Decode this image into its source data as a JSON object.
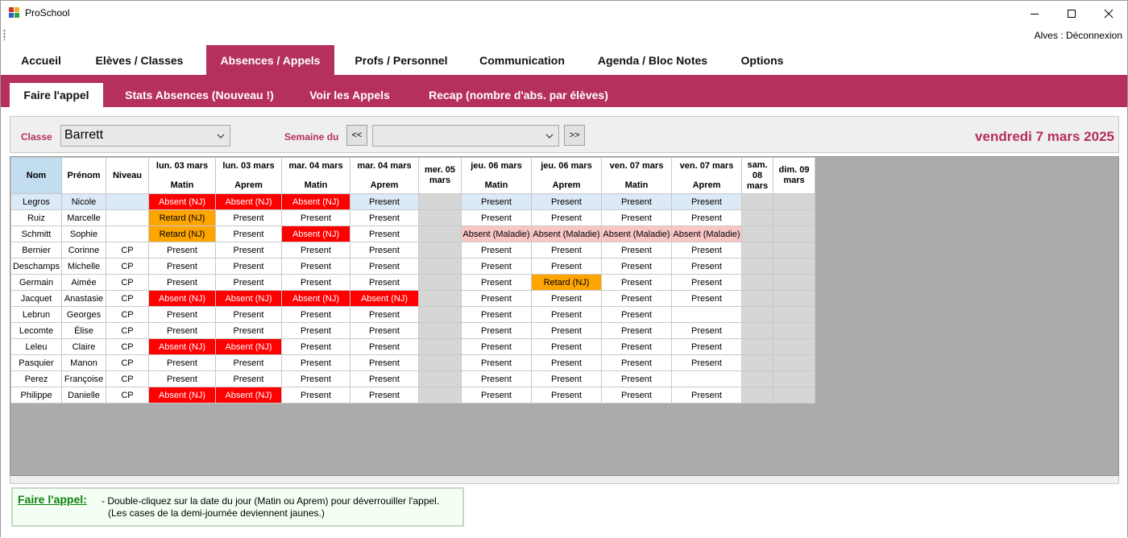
{
  "window": {
    "title": "ProSchool",
    "user_status": "Alves : Déconnexion",
    "icons": {
      "app": "app-icon",
      "minimize": "minimize-icon",
      "maximize": "maximize-icon",
      "close": "close-icon"
    }
  },
  "main_tabs": [
    {
      "label": "Accueil",
      "active": false
    },
    {
      "label": "Elèves / Classes",
      "active": false
    },
    {
      "label": "Absences / Appels",
      "active": true
    },
    {
      "label": "Profs / Personnel",
      "active": false
    },
    {
      "label": "Communication",
      "active": false
    },
    {
      "label": "Agenda / Bloc Notes",
      "active": false
    },
    {
      "label": "Options",
      "active": false
    }
  ],
  "sub_tabs": [
    {
      "label": "Faire l'appel",
      "active": true
    },
    {
      "label": "Stats Absences (Nouveau !)",
      "active": false
    },
    {
      "label": "Voir les Appels",
      "active": false
    },
    {
      "label": "Recap (nombre d'abs. par élèves)",
      "active": false
    }
  ],
  "filters": {
    "classe_label": "Classe",
    "classe_value": "Barrett",
    "semaine_label": "Semaine du",
    "semaine_value": "",
    "prev_label": "<<",
    "next_label": ">>",
    "current_date": "vendredi 7 mars 2025"
  },
  "grid": {
    "columns": [
      {
        "l1": "Nom",
        "l2": ""
      },
      {
        "l1": "Prénom",
        "l2": ""
      },
      {
        "l1": "Niveau",
        "l2": ""
      },
      {
        "l1": "lun. 03 mars",
        "l2": "Matin"
      },
      {
        "l1": "lun. 03 mars",
        "l2": "Aprem"
      },
      {
        "l1": "mar. 04 mars",
        "l2": "Matin"
      },
      {
        "l1": "mar. 04 mars",
        "l2": "Aprem"
      },
      {
        "l1": "mer. 05 mars",
        "l2": ""
      },
      {
        "l1": "jeu. 06 mars",
        "l2": "Matin"
      },
      {
        "l1": "jeu. 06 mars",
        "l2": "Aprem"
      },
      {
        "l1": "ven. 07 mars",
        "l2": "Matin"
      },
      {
        "l1": "ven. 07 mars",
        "l2": "Aprem"
      },
      {
        "l1": "sam. 08 mars",
        "l2": ""
      },
      {
        "l1": "dim. 09 mars",
        "l2": ""
      }
    ],
    "status_colors": {
      "Absent (NJ)": "#ff0000",
      "Retard (NJ)": "#ffa500",
      "Absent (Maladie)": "#f9c6c6",
      "selected_row": "#dce9f7",
      "non_school_day": "#d6d6d6"
    },
    "rows": [
      {
        "nom": "Legros",
        "prenom": "Nicole",
        "niveau": "",
        "selected": true,
        "s": [
          "Absent (NJ)",
          "Absent (NJ)",
          "Absent (NJ)",
          "Present",
          "",
          "Present",
          "Present",
          "Present",
          "Present",
          "",
          ""
        ]
      },
      {
        "nom": "Ruiz",
        "prenom": "Marcelle",
        "niveau": "",
        "s": [
          "Retard (NJ)",
          "Present",
          "Present",
          "Present",
          "",
          "Present",
          "Present",
          "Present",
          "Present",
          "",
          ""
        ]
      },
      {
        "nom": "Schmitt",
        "prenom": "Sophie",
        "niveau": "",
        "s": [
          "Retard (NJ)",
          "Present",
          "Absent (NJ)",
          "Present",
          "",
          "Absent (Maladie)",
          "Absent (Maladie)",
          "Absent (Maladie)",
          "Absent (Maladie)",
          "",
          ""
        ]
      },
      {
        "nom": "Bernier",
        "prenom": "Corinne",
        "niveau": "CP",
        "s": [
          "Present",
          "Present",
          "Present",
          "Present",
          "",
          "Present",
          "Present",
          "Present",
          "Present",
          "",
          ""
        ]
      },
      {
        "nom": "Deschamps",
        "prenom": "Michelle",
        "niveau": "CP",
        "s": [
          "Present",
          "Present",
          "Present",
          "Present",
          "",
          "Present",
          "Present",
          "Present",
          "Present",
          "",
          ""
        ]
      },
      {
        "nom": "Germain",
        "prenom": "Aimée",
        "niveau": "CP",
        "s": [
          "Present",
          "Present",
          "Present",
          "Present",
          "",
          "Present",
          "Retard (NJ)",
          "Present",
          "Present",
          "",
          ""
        ]
      },
      {
        "nom": "Jacquet",
        "prenom": "Anastasie",
        "niveau": "CP",
        "s": [
          "Absent (NJ)",
          "Absent (NJ)",
          "Absent (NJ)",
          "Absent (NJ)",
          "",
          "Present",
          "Present",
          "Present",
          "Present",
          "",
          ""
        ]
      },
      {
        "nom": "Lebrun",
        "prenom": "Georges",
        "niveau": "CP",
        "s": [
          "Present",
          "Present",
          "Present",
          "Present",
          "",
          "Present",
          "Present",
          "Present",
          "",
          "",
          ""
        ]
      },
      {
        "nom": "Lecomte",
        "prenom": "Élise",
        "niveau": "CP",
        "s": [
          "Present",
          "Present",
          "Present",
          "Present",
          "",
          "Present",
          "Present",
          "Present",
          "Present",
          "",
          ""
        ]
      },
      {
        "nom": "Leleu",
        "prenom": "Claire",
        "niveau": "CP",
        "s": [
          "Absent (NJ)",
          "Absent (NJ)",
          "Present",
          "Present",
          "",
          "Present",
          "Present",
          "Present",
          "Present",
          "",
          ""
        ]
      },
      {
        "nom": "Pasquier",
        "prenom": "Manon",
        "niveau": "CP",
        "s": [
          "Present",
          "Present",
          "Present",
          "Present",
          "",
          "Present",
          "Present",
          "Present",
          "Present",
          "",
          ""
        ]
      },
      {
        "nom": "Perez",
        "prenom": "Françoise",
        "niveau": "CP",
        "s": [
          "Present",
          "Present",
          "Present",
          "Present",
          "",
          "Present",
          "Present",
          "Present",
          "",
          "",
          ""
        ]
      },
      {
        "nom": "Philippe",
        "prenom": "Danielle",
        "niveau": "CP",
        "s": [
          "Absent (NJ)",
          "Absent (NJ)",
          "Present",
          "Present",
          "",
          "Present",
          "Present",
          "Present",
          "Present",
          "",
          ""
        ]
      }
    ]
  },
  "help": {
    "title": "Faire l'appel:",
    "line1": "- Double-cliquez sur la date du jour (Matin ou Aprem) pour déverrouiller l'appel.",
    "line2": "(Les cases de la demi-journée deviennent jaunes.)"
  }
}
